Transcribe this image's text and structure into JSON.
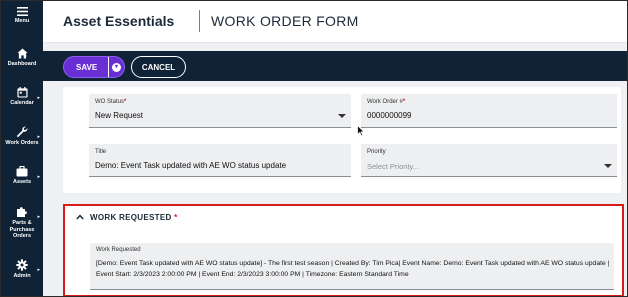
{
  "sidebar": {
    "menu_label": "Menu",
    "items": [
      {
        "label": "Dashboard",
        "icon": "home-icon"
      },
      {
        "label": "Calendar",
        "icon": "calendar-icon"
      },
      {
        "label": "Work Orders",
        "icon": "wrench-icon"
      },
      {
        "label": "Assets",
        "icon": "briefcase-icon"
      },
      {
        "label": "Parts & Purchase Orders",
        "label_lines": [
          "Parts &",
          "Purchase",
          "Orders"
        ],
        "icon": "puzzle-icon"
      },
      {
        "label": "Admin",
        "icon": "gear-icon"
      }
    ]
  },
  "header": {
    "app_title": "Asset Essentials",
    "page_title": "WORK ORDER FORM"
  },
  "toolbar": {
    "save_label": "SAVE",
    "cancel_label": "CANCEL"
  },
  "form": {
    "wo_status": {
      "label": "WO Status",
      "value": "New Request",
      "required": true
    },
    "work_order_number": {
      "label": "Work Order #",
      "value": "0000000099",
      "required": true
    },
    "title": {
      "label": "Title",
      "value": "Demo: Event Task updated with AE WO status update"
    },
    "priority": {
      "label": "Priority",
      "placeholder": "Select Priority..."
    }
  },
  "work_requested": {
    "section_title": "WORK REQUESTED",
    "required_mark": "*",
    "field_label": "Work Requested",
    "value": "[Demo: Event Task updated with AE WO status update] - The first test season | Created By: Tim Pica| Event Name: Demo: Event Task updated with AE WO status update | Event Start: 2/3/2023 2:00:00 PM | Event End: 2/3/2023 3:00:00 PM | Timezone: Eastern Standard Time"
  },
  "colors": {
    "sidebar_bg": "#0f2236",
    "accent_purple": "#6a2fd4",
    "highlight_red": "#d81a1a"
  }
}
